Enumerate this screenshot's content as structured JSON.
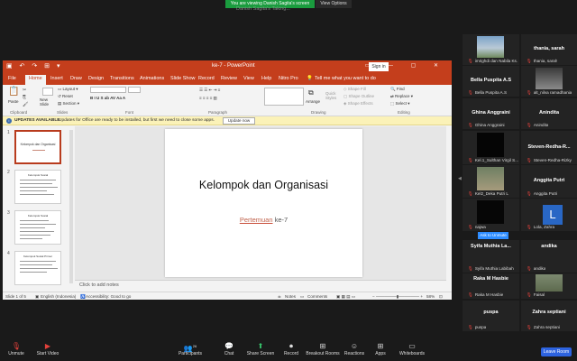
{
  "zoom": {
    "share_banner": "You are viewing Danish Sagita's screen",
    "view_options": "View Options",
    "ghost_title": "Danish Sagita's Taking...",
    "leave_label": "Leave Room",
    "ask_to_unmute": "Ask to Unmute",
    "toolbar": [
      {
        "label": "Unmute",
        "icon": "mic-muted-icon"
      },
      {
        "label": "Start Video",
        "icon": "video-off-icon"
      },
      {
        "label": "Participants",
        "icon": "participants-icon",
        "count": "26"
      },
      {
        "label": "Chat",
        "icon": "chat-icon"
      },
      {
        "label": "Share Screen",
        "icon": "share-screen-icon"
      },
      {
        "label": "Record",
        "icon": "record-icon"
      },
      {
        "label": "Breakout Rooms",
        "icon": "breakout-rooms-icon"
      },
      {
        "label": "Reactions",
        "icon": "reactions-icon"
      },
      {
        "label": "Apps",
        "icon": "apps-icon"
      },
      {
        "label": "Whiteboards",
        "icon": "whiteboard-icon"
      }
    ],
    "participants": [
      {
        "name": "",
        "label": "imrighdi dan Nabila Ks."
      },
      {
        "name": "thania, sarah",
        "label": "thania, sarah"
      },
      {
        "name": "Bella Puspita A.S",
        "label": "Bella Puspita A.S"
      },
      {
        "name": "",
        "label": "alt_nilva ramadhania"
      },
      {
        "name": "Ghina Anggraini",
        "label": "Ghina Anggraini"
      },
      {
        "name": "Anindita",
        "label": "Anindita"
      },
      {
        "name": "",
        "label": "Kel.1_Sulthan Virgil S..."
      },
      {
        "name": "Steven-Redha-R...",
        "label": "Steven-Redha-Rizky"
      },
      {
        "name": "",
        "label": "Kel2_Deka Putri L"
      },
      {
        "name": "Anggita Putri",
        "label": "Anggita Putri"
      },
      {
        "name": "",
        "label": "najwa"
      },
      {
        "name": "",
        "label": "Lola, Zahra"
      },
      {
        "name": "Syifa Muthia La...",
        "label": "Syifa Muthia Labibah"
      },
      {
        "name": "andika",
        "label": "andika"
      },
      {
        "name": "Raka M Hasbie",
        "label": "Raka M Hasbie"
      },
      {
        "name": "",
        "label": "Faisal"
      },
      {
        "name": "puspa",
        "label": "puspa"
      },
      {
        "name": "Zahra septiani",
        "label": "Zahra septiani"
      }
    ],
    "colors": {
      "banner": "#1a9c3e",
      "leave": "#2d63e0",
      "muted": "#e3413b"
    }
  },
  "ppt": {
    "doc_title": "ke-7  -  PowerPoint",
    "sign_in": "Sign in",
    "tabs": [
      "File",
      "Home",
      "Insert",
      "Draw",
      "Design",
      "Transitions",
      "Animations",
      "Slide Show",
      "Record",
      "Review",
      "View",
      "Help",
      "Nitro Pro"
    ],
    "tell_me": "Tell me what you want to do",
    "ribbon": {
      "paste": "Paste",
      "new_slide": "New Slide",
      "layout": "Layout",
      "reset": "Reset",
      "section": "Section",
      "arrange": "Arrange",
      "quick_styles": "Quick Styles",
      "shape_fill": "Shape Fill",
      "shape_outline": "Shape Outline",
      "shape_effects": "Shape Effects",
      "find": "Find",
      "replace": "Replace",
      "select": "Select",
      "groups": {
        "clipboard": "Clipboard",
        "slides": "Slides",
        "font": "Font",
        "paragraph": "Paragraph",
        "drawing": "Drawing",
        "editing": "Editing"
      }
    },
    "update_bar": {
      "title": "UPDATES AVAILABLE",
      "message": "Updates for Office are ready to be installed, but first we need to close some apps.",
      "button": "Update now"
    },
    "thumbnails": [
      {
        "num": "1",
        "title": "Kelompok dan Organisasi"
      },
      {
        "num": "2",
        "title": "Kelompok Sosial"
      },
      {
        "num": "3",
        "title": "Kelompok Sosial"
      },
      {
        "num": "4",
        "title": "Kelompok Sosial Primer"
      }
    ],
    "slide": {
      "title": "Kelompok dan Organisasi",
      "sub_underlined": "Pertemuan",
      "sub_rest": " ke-7"
    },
    "notes_placeholder": "Click to add notes",
    "status": {
      "slide": "Slide 1 of 5",
      "language": "English (Indonesia)",
      "accessibility": "Accessibility: Good to go",
      "notes": "Notes",
      "comments": "Comments",
      "zoom": "58%"
    }
  }
}
